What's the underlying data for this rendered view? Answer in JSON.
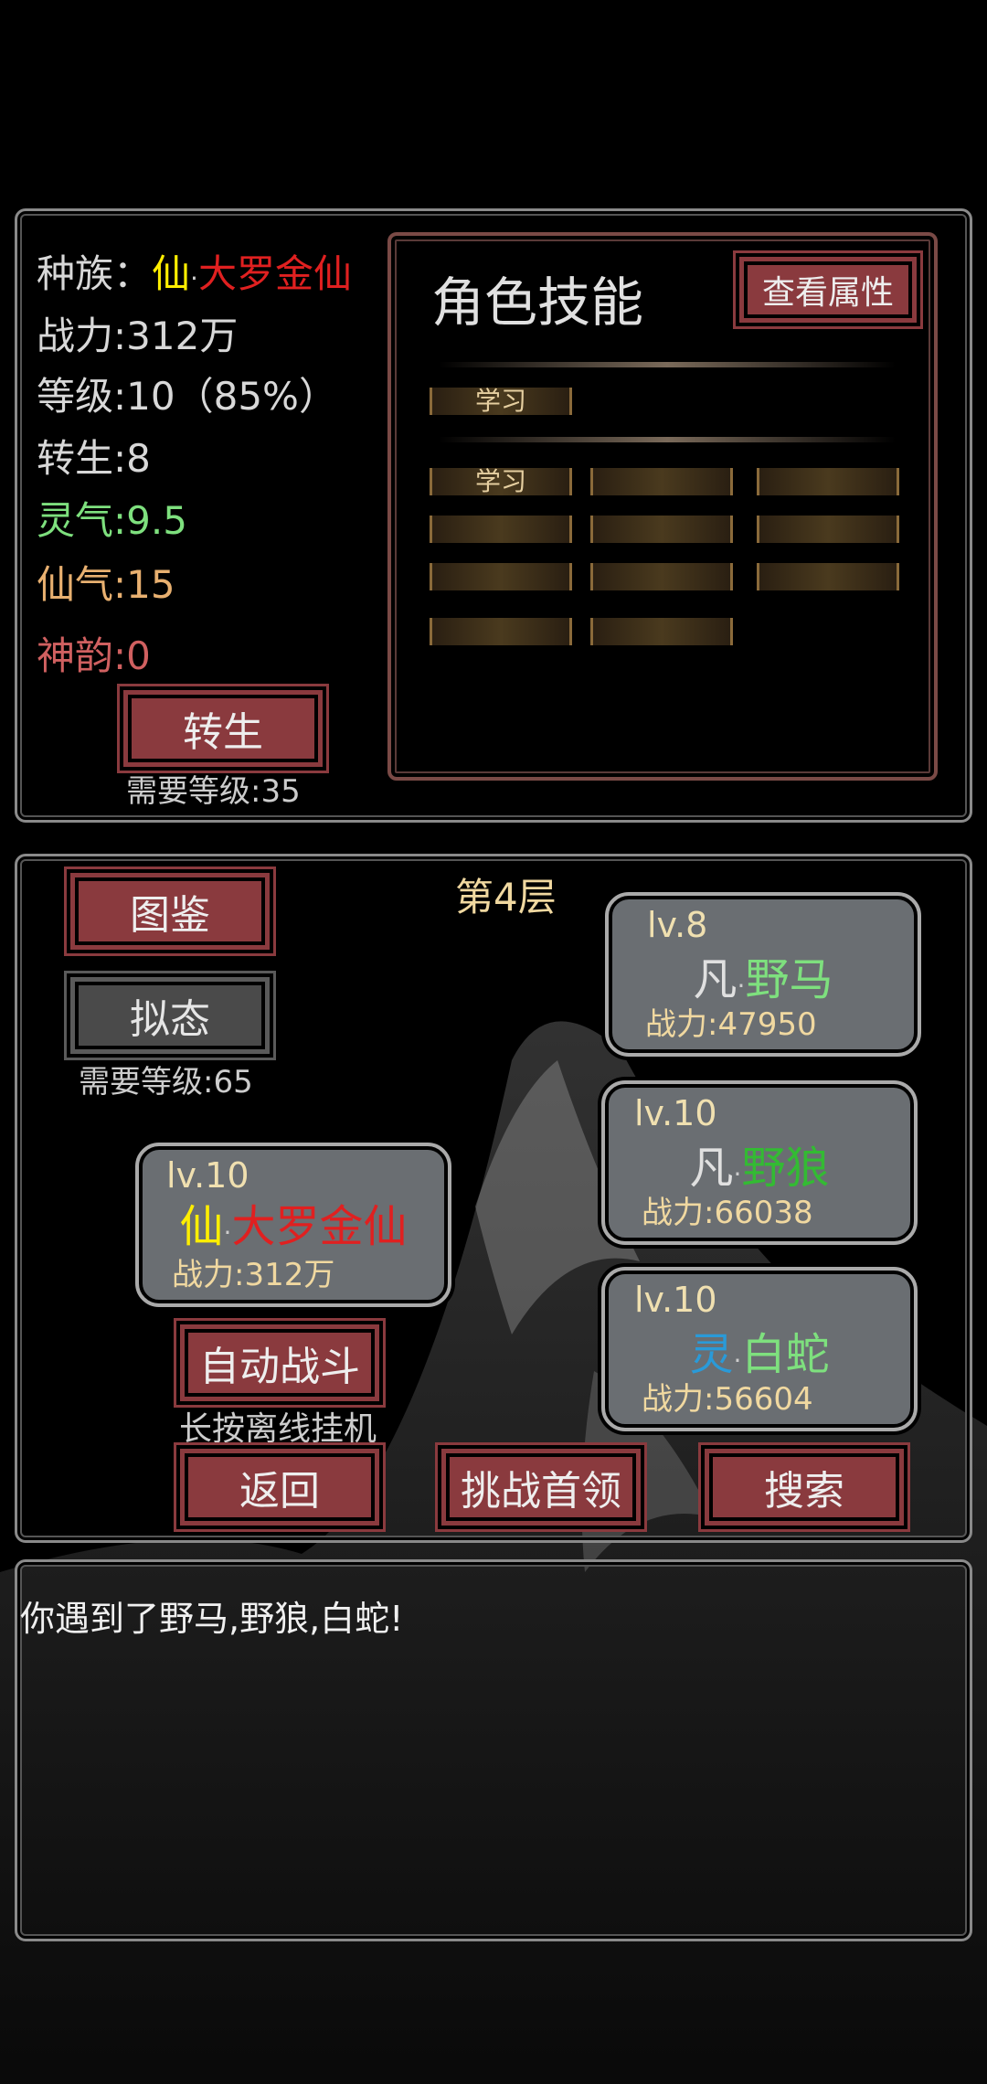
{
  "stats": {
    "race_label": "种族：",
    "race_prefix": "仙",
    "race_sep": "·",
    "race_name": "大罗金仙",
    "power": "战力:312万",
    "level": "等级:10（85%）",
    "rebirth": "转生:8",
    "spirit": "灵气:9.5",
    "immortal_qi": "仙气:15",
    "divine": "神韵:0"
  },
  "rebirth_button": {
    "label": "转生",
    "requirement": "需要等级:35"
  },
  "skills": {
    "title": "角色技能",
    "view_attr_label": "查看属性",
    "learn_label_1": "学习",
    "learn_label_2": "学习"
  },
  "battle": {
    "floor": "第4层",
    "atlas_label": "图鉴",
    "mimic_label": "拟态",
    "mimic_requirement": "需要等级:65",
    "auto_battle_label": "自动战斗",
    "auto_battle_hint": "长按离线挂机",
    "back_label": "返回",
    "boss_label": "挑战首领",
    "search_label": "搜索",
    "player": {
      "lv": "lv.10",
      "rank": "仙",
      "sep": "·",
      "name": "大罗金仙",
      "power": "战力:312万"
    },
    "enemies": [
      {
        "lv": "lv.8",
        "rank": "凡",
        "sep": "·",
        "name": "野马",
        "power": "战力:47950"
      },
      {
        "lv": "lv.10",
        "rank": "凡",
        "sep": "·",
        "name": "野狼",
        "power": "战力:66038"
      },
      {
        "lv": "lv.10",
        "rank": "灵",
        "sep": "·",
        "name": "白蛇",
        "power": "战力:56604"
      }
    ]
  },
  "log": {
    "message": "你遇到了野马,野狼,白蛇!"
  },
  "colors": {
    "gold": "#ffee00",
    "red": "#e02020",
    "green_light": "#7ee07e",
    "green": "#33bb33",
    "blue": "#2a9ad8",
    "peach": "#e8b070",
    "rose": "#d06060",
    "button_red": "#8a3a3e"
  }
}
